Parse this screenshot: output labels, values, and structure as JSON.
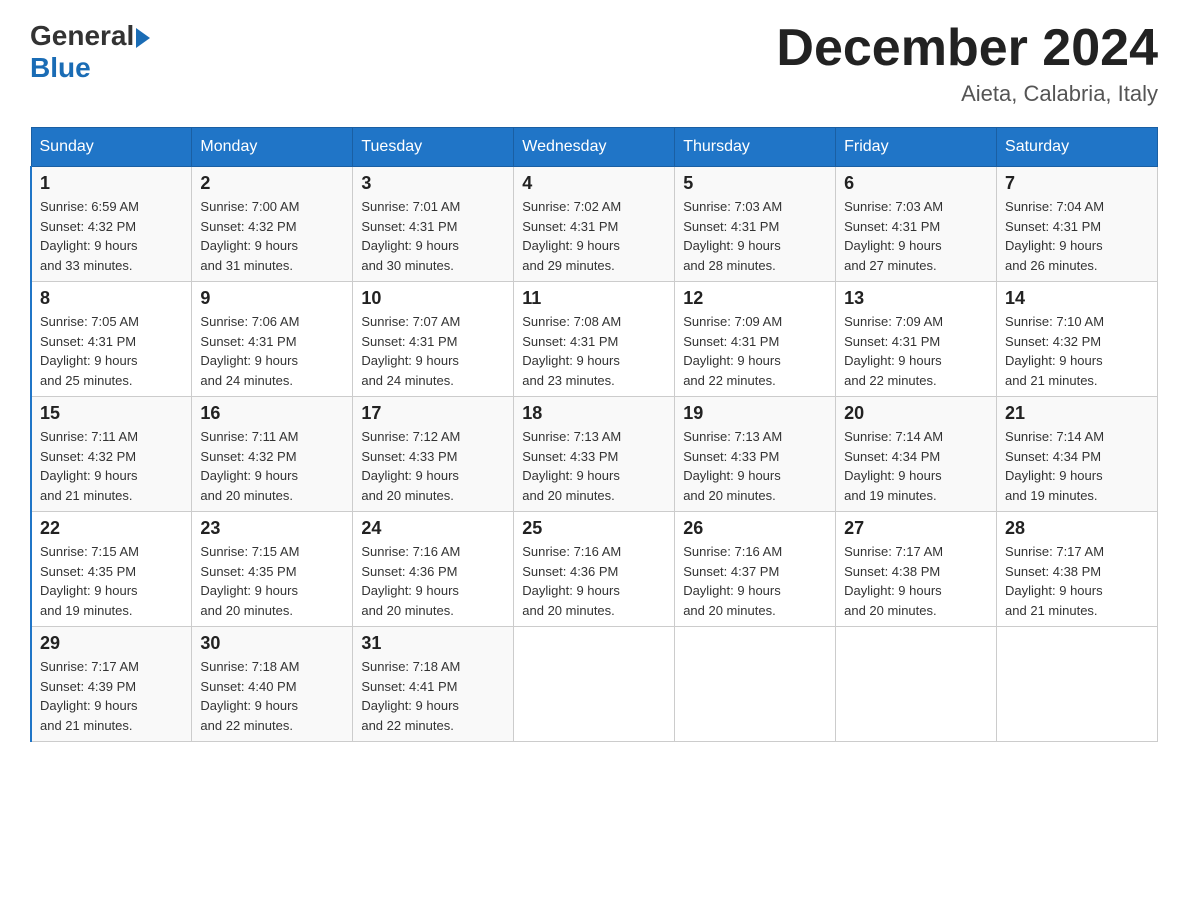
{
  "logo": {
    "general": "General",
    "blue": "Blue"
  },
  "title": "December 2024",
  "subtitle": "Aieta, Calabria, Italy",
  "weekdays": [
    "Sunday",
    "Monday",
    "Tuesday",
    "Wednesday",
    "Thursday",
    "Friday",
    "Saturday"
  ],
  "weeks": [
    [
      {
        "day": "1",
        "sunrise": "6:59 AM",
        "sunset": "4:32 PM",
        "daylight": "9 hours and 33 minutes."
      },
      {
        "day": "2",
        "sunrise": "7:00 AM",
        "sunset": "4:32 PM",
        "daylight": "9 hours and 31 minutes."
      },
      {
        "day": "3",
        "sunrise": "7:01 AM",
        "sunset": "4:31 PM",
        "daylight": "9 hours and 30 minutes."
      },
      {
        "day": "4",
        "sunrise": "7:02 AM",
        "sunset": "4:31 PM",
        "daylight": "9 hours and 29 minutes."
      },
      {
        "day": "5",
        "sunrise": "7:03 AM",
        "sunset": "4:31 PM",
        "daylight": "9 hours and 28 minutes."
      },
      {
        "day": "6",
        "sunrise": "7:03 AM",
        "sunset": "4:31 PM",
        "daylight": "9 hours and 27 minutes."
      },
      {
        "day": "7",
        "sunrise": "7:04 AM",
        "sunset": "4:31 PM",
        "daylight": "9 hours and 26 minutes."
      }
    ],
    [
      {
        "day": "8",
        "sunrise": "7:05 AM",
        "sunset": "4:31 PM",
        "daylight": "9 hours and 25 minutes."
      },
      {
        "day": "9",
        "sunrise": "7:06 AM",
        "sunset": "4:31 PM",
        "daylight": "9 hours and 24 minutes."
      },
      {
        "day": "10",
        "sunrise": "7:07 AM",
        "sunset": "4:31 PM",
        "daylight": "9 hours and 24 minutes."
      },
      {
        "day": "11",
        "sunrise": "7:08 AM",
        "sunset": "4:31 PM",
        "daylight": "9 hours and 23 minutes."
      },
      {
        "day": "12",
        "sunrise": "7:09 AM",
        "sunset": "4:31 PM",
        "daylight": "9 hours and 22 minutes."
      },
      {
        "day": "13",
        "sunrise": "7:09 AM",
        "sunset": "4:31 PM",
        "daylight": "9 hours and 22 minutes."
      },
      {
        "day": "14",
        "sunrise": "7:10 AM",
        "sunset": "4:32 PM",
        "daylight": "9 hours and 21 minutes."
      }
    ],
    [
      {
        "day": "15",
        "sunrise": "7:11 AM",
        "sunset": "4:32 PM",
        "daylight": "9 hours and 21 minutes."
      },
      {
        "day": "16",
        "sunrise": "7:11 AM",
        "sunset": "4:32 PM",
        "daylight": "9 hours and 20 minutes."
      },
      {
        "day": "17",
        "sunrise": "7:12 AM",
        "sunset": "4:33 PM",
        "daylight": "9 hours and 20 minutes."
      },
      {
        "day": "18",
        "sunrise": "7:13 AM",
        "sunset": "4:33 PM",
        "daylight": "9 hours and 20 minutes."
      },
      {
        "day": "19",
        "sunrise": "7:13 AM",
        "sunset": "4:33 PM",
        "daylight": "9 hours and 20 minutes."
      },
      {
        "day": "20",
        "sunrise": "7:14 AM",
        "sunset": "4:34 PM",
        "daylight": "9 hours and 19 minutes."
      },
      {
        "day": "21",
        "sunrise": "7:14 AM",
        "sunset": "4:34 PM",
        "daylight": "9 hours and 19 minutes."
      }
    ],
    [
      {
        "day": "22",
        "sunrise": "7:15 AM",
        "sunset": "4:35 PM",
        "daylight": "9 hours and 19 minutes."
      },
      {
        "day": "23",
        "sunrise": "7:15 AM",
        "sunset": "4:35 PM",
        "daylight": "9 hours and 20 minutes."
      },
      {
        "day": "24",
        "sunrise": "7:16 AM",
        "sunset": "4:36 PM",
        "daylight": "9 hours and 20 minutes."
      },
      {
        "day": "25",
        "sunrise": "7:16 AM",
        "sunset": "4:36 PM",
        "daylight": "9 hours and 20 minutes."
      },
      {
        "day": "26",
        "sunrise": "7:16 AM",
        "sunset": "4:37 PM",
        "daylight": "9 hours and 20 minutes."
      },
      {
        "day": "27",
        "sunrise": "7:17 AM",
        "sunset": "4:38 PM",
        "daylight": "9 hours and 20 minutes."
      },
      {
        "day": "28",
        "sunrise": "7:17 AM",
        "sunset": "4:38 PM",
        "daylight": "9 hours and 21 minutes."
      }
    ],
    [
      {
        "day": "29",
        "sunrise": "7:17 AM",
        "sunset": "4:39 PM",
        "daylight": "9 hours and 21 minutes."
      },
      {
        "day": "30",
        "sunrise": "7:18 AM",
        "sunset": "4:40 PM",
        "daylight": "9 hours and 22 minutes."
      },
      {
        "day": "31",
        "sunrise": "7:18 AM",
        "sunset": "4:41 PM",
        "daylight": "9 hours and 22 minutes."
      },
      null,
      null,
      null,
      null
    ]
  ],
  "labels": {
    "sunrise": "Sunrise:",
    "sunset": "Sunset:",
    "daylight": "Daylight:"
  }
}
